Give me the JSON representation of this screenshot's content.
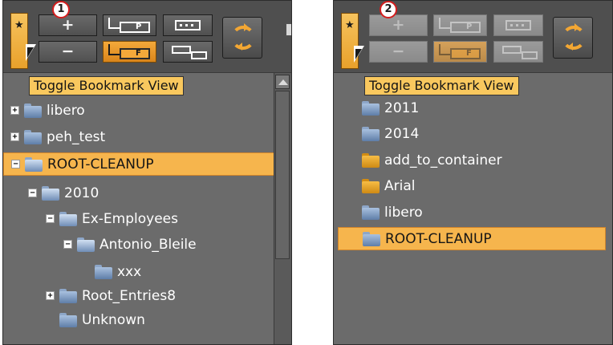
{
  "callouts": [
    "1",
    "2"
  ],
  "tooltip": "Toggle Bookmark View",
  "toolbar": {
    "bookmark_icon": "star-icon",
    "plus_label": "+",
    "minus_label": "−",
    "p_label": "P",
    "f_label": "F",
    "refresh_icon": "refresh-icon"
  },
  "left_tree": {
    "items": [
      {
        "label": "libero",
        "expander": "+"
      },
      {
        "label": "peh_test",
        "expander": "+"
      },
      {
        "label": "ROOT-CLEANUP",
        "expander": "−",
        "selected": true
      },
      {
        "label": "2010",
        "expander": "−"
      },
      {
        "label": "Ex-Employees",
        "expander": "−"
      },
      {
        "label": "Antonio_Bleile",
        "expander": "−"
      },
      {
        "label": "xxx",
        "expander": ""
      },
      {
        "label": "Root_Entries8",
        "expander": "+"
      },
      {
        "label": "Unknown",
        "expander": ""
      }
    ]
  },
  "right_tree": {
    "items": [
      {
        "label": "2011",
        "folder": "blue"
      },
      {
        "label": "2014",
        "folder": "blue"
      },
      {
        "label": "add_to_container",
        "folder": "orange"
      },
      {
        "label": "Arial",
        "folder": "orange"
      },
      {
        "label": "libero",
        "folder": "blue"
      },
      {
        "label": "ROOT-CLEANUP",
        "folder": "blue",
        "selected": true
      }
    ]
  },
  "colors": {
    "selection": "#f6b54d",
    "tooltip_bg": "#f9c85e",
    "panel_bg": "#6b6b6b",
    "badge_border": "#d31d1d"
  }
}
